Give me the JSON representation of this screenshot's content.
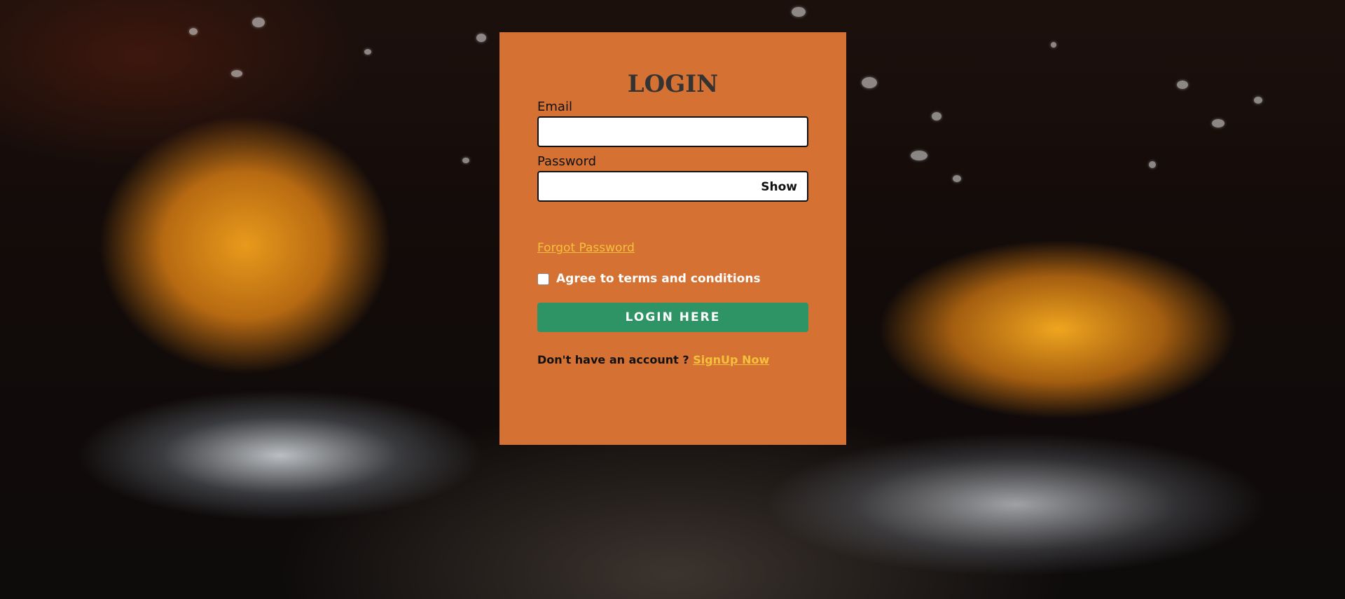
{
  "login": {
    "title": "LOGIN",
    "email_label": "Email",
    "email_value": "",
    "password_label": "Password",
    "password_value": "",
    "show_label": "Show",
    "forgot_label": "Forgot Password",
    "terms_label": "Agree to terms and conditions",
    "terms_checked": false,
    "submit_label": "LOGIN HERE",
    "no_account_text": "Don't have an account ?",
    "signup_label": "SignUp Now"
  },
  "colors": {
    "card": "#d57233",
    "button": "#2e9465",
    "link": "#f6c13a",
    "title": "#333333"
  },
  "background": {
    "icon": "whiskey-glasses-ice-image"
  }
}
